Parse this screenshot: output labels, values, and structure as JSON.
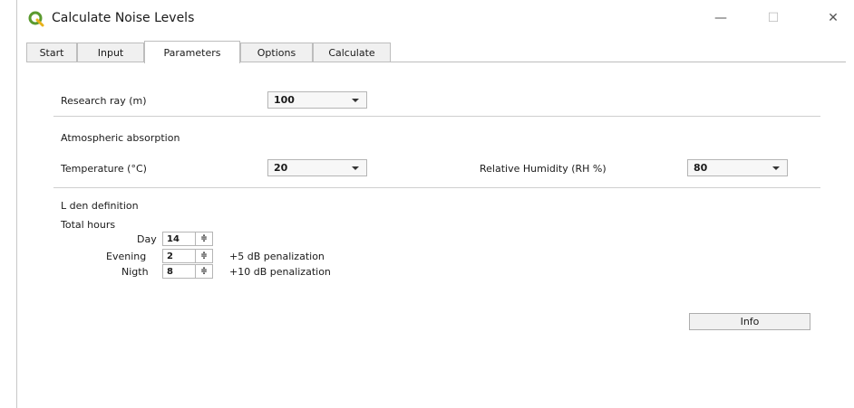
{
  "window": {
    "title": "Calculate Noise Levels",
    "minimize_glyph": "—",
    "maximize_glyph": "☐",
    "close_glyph": "✕",
    "icon": "qgis-icon",
    "accent": "#5b9a2f"
  },
  "tabs": [
    {
      "label": "Start"
    },
    {
      "label": "Input"
    },
    {
      "label": "Parameters"
    },
    {
      "label": "Options"
    },
    {
      "label": "Calculate"
    }
  ],
  "active_tab": "Parameters",
  "parameters": {
    "research_ray": {
      "label": "Research ray (m)",
      "value": "100"
    },
    "atmospheric_heading": "Atmospheric absorption",
    "temperature": {
      "label": "Temperature (°C)",
      "value": "20"
    },
    "humidity": {
      "label": "Relative Humidity (RH %)",
      "value": "80"
    },
    "lden_heading": "L den definition",
    "total_hours_label": "Total hours",
    "day": {
      "label": "Day",
      "value": "14"
    },
    "evening": {
      "label": "Evening",
      "value": "2",
      "note": "+5 dB penalization"
    },
    "night": {
      "label": "Nigth",
      "value": "8",
      "note": "+10 dB penalization"
    },
    "spin_glyph": "≑",
    "info_button": "Info"
  }
}
